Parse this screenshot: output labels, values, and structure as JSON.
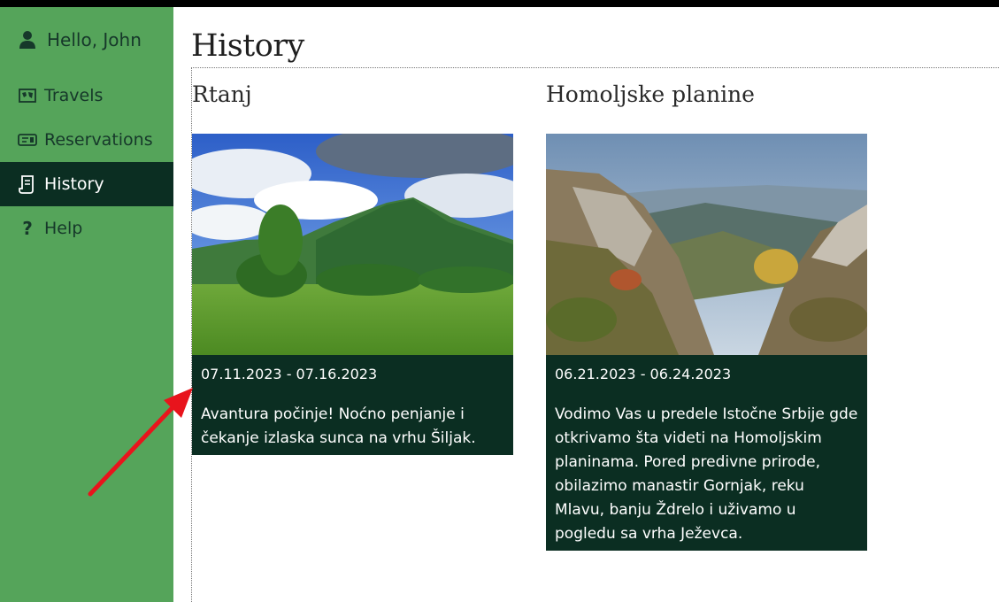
{
  "sidebar": {
    "greeting": "Hello, John",
    "items": [
      {
        "label": "Travels",
        "icon": "map-icon"
      },
      {
        "label": "Reservations",
        "icon": "ticket-icon"
      },
      {
        "label": "History",
        "icon": "scroll-icon",
        "active": true
      },
      {
        "label": "Help",
        "icon": "question-icon"
      }
    ]
  },
  "main": {
    "title": "History",
    "cards": [
      {
        "title": "Rtanj",
        "dates": "07.11.2023 - 07.16.2023",
        "description": "Avantura počinje! Noćno penjanje i čekanje izlaska sunca na vrhu Šiljak."
      },
      {
        "title": "Homoljske planine",
        "dates": "06.21.2023 - 06.24.2023",
        "description": "Vodimo Vas u predele Istočne Srbije gde otkrivamo šta videti na Homoljskim planinama. Pored predivne prirode, obilazimo manastir Gornjak, reku Mlavu, banju Ždrelo i uživamo u pogledu sa vrha Ježevca."
      }
    ]
  },
  "colors": {
    "sidebar_bg": "#55a45a",
    "sidebar_active_bg": "#0b2e22",
    "card_body_bg": "#0b2e22",
    "arrow": "#e8141c"
  }
}
